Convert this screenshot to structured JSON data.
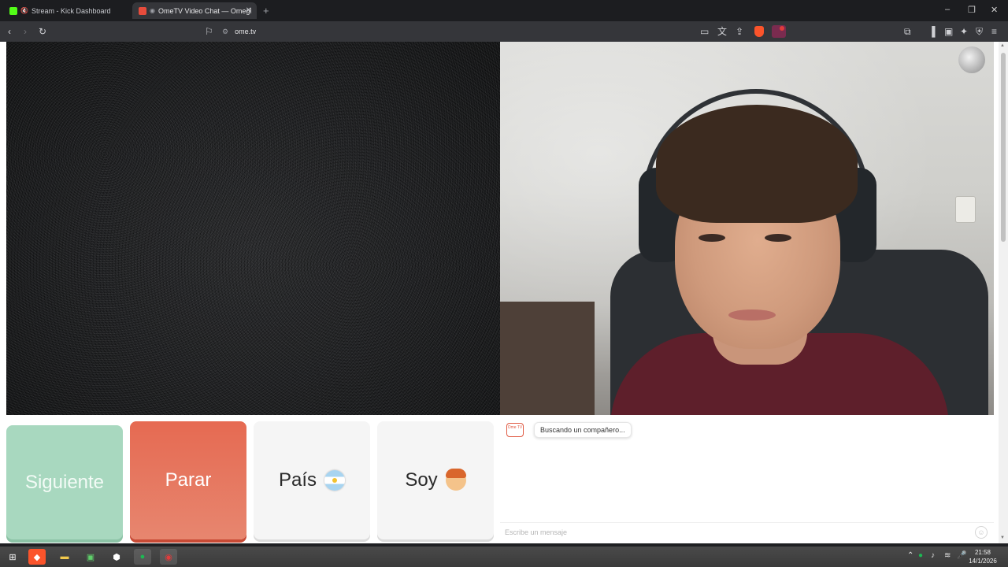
{
  "browser": {
    "tabs": [
      {
        "title": "Stream - Kick Dashboard",
        "active": false
      },
      {
        "title": "OmeTV Video Chat — Omegl",
        "active": true
      }
    ],
    "url": "ome.tv"
  },
  "controls": {
    "next_label": "Siguiente",
    "stop_label": "Parar",
    "country_label": "País",
    "gender_label": "Soy"
  },
  "chat": {
    "logo_text": "Ome TV",
    "status_message": "Buscando un compañero...",
    "input_placeholder": "Escribe un mensaje"
  },
  "taskbar": {
    "language": "ENG",
    "time": "21:58",
    "date": "14/1/2026"
  },
  "colors": {
    "next_button": "#a8d8bf",
    "stop_button": "#e66a52",
    "brand": "#e05a43"
  },
  "icons": {
    "country_flag": "argentina-flag-icon",
    "gender_avatar": "boy-emoji-icon"
  }
}
